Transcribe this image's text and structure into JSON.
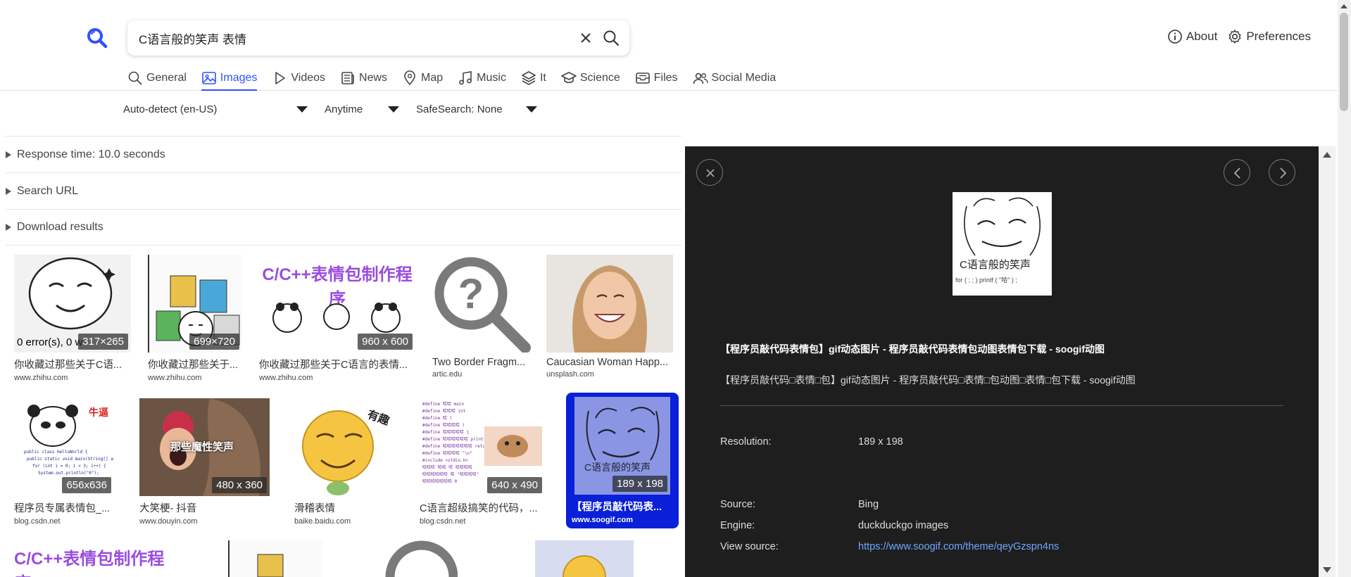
{
  "search": {
    "query": "C语言般的笑声 表情"
  },
  "top_nav": {
    "about": "About",
    "preferences": "Preferences"
  },
  "categories": [
    {
      "label": "General"
    },
    {
      "label": "Images"
    },
    {
      "label": "Videos"
    },
    {
      "label": "News"
    },
    {
      "label": "Map"
    },
    {
      "label": "Music"
    },
    {
      "label": "It"
    },
    {
      "label": "Science"
    },
    {
      "label": "Files"
    },
    {
      "label": "Social Media"
    }
  ],
  "filters": {
    "language": "Auto-detect (en-US)",
    "time": "Anytime",
    "safesearch": "SafeSearch: None"
  },
  "summaries": {
    "response_time": "Response time: 10.0 seconds",
    "search_url": "Search URL",
    "download": "Download results"
  },
  "images": [
    {
      "title": "你收藏过那些关于C语...",
      "source": "www.zhihu.com",
      "resolution": "317×265",
      "overlay": "0 error(s), 0 w"
    },
    {
      "title": "你收藏过那些关于...",
      "source": "www.zhihu.com",
      "resolution": "699×720"
    },
    {
      "title": "你收藏过那些关于C语言的表情...",
      "source": "www.zhihu.com",
      "resolution": "960 x 600",
      "banner": "C/C++表情包制作程序"
    },
    {
      "title": "Two Border Fragm...",
      "source": "artic.edu"
    },
    {
      "title": "Caucasian Woman Happ...",
      "source": "unsplash.com"
    },
    {
      "title": "程序员专属表情包_...",
      "source": "blog.csdn.net",
      "resolution": "656x636",
      "badge_text": "牛逼"
    },
    {
      "title": "大笑梗- 抖音",
      "source": "www.douyin.com",
      "resolution": "480 x 360",
      "caption": "那些魔性笑声"
    },
    {
      "title": "滑稽表情",
      "source": "baike.baidu.com",
      "badge_text": "有趣"
    },
    {
      "title": "C语言超级搞笑的代码，...",
      "source": "blog.csdn.net",
      "resolution": "640 x 490"
    },
    {
      "title": "【程序员敲代码表...",
      "source": "www.soogif.com",
      "resolution": "189 x 198",
      "caption": "C语言般的笑声"
    }
  ],
  "row3_banner": "C/C++表情包制作程序",
  "detail": {
    "title": "【程序员敲代码表情包】gif动态图片 - 程序员敲代码表情包动图表情包下载 - soogif动图",
    "description": "【程序员敲代码□表情□包】gif动态图片 - 程序员敲代码□表情□包动图□表情□包下载 - soogif动图",
    "preview_caption": "C语言般的笑声",
    "preview_code": "for ( ; ; ) printf ( \"哈\" ) ;",
    "resolution_label": "Resolution:",
    "resolution_value": "189 x 198",
    "source_label": "Source:",
    "source_value": "Bing",
    "engine_label": "Engine:",
    "engine_value": "duckduckgo images",
    "view_source_label": "View source:",
    "view_source_value": "https://www.soogif.com/theme/qeyGzspn4ns"
  },
  "colors": {
    "accent": "#3050ff",
    "selected": "#0a1fd8",
    "panel": "#1e1e1e"
  }
}
